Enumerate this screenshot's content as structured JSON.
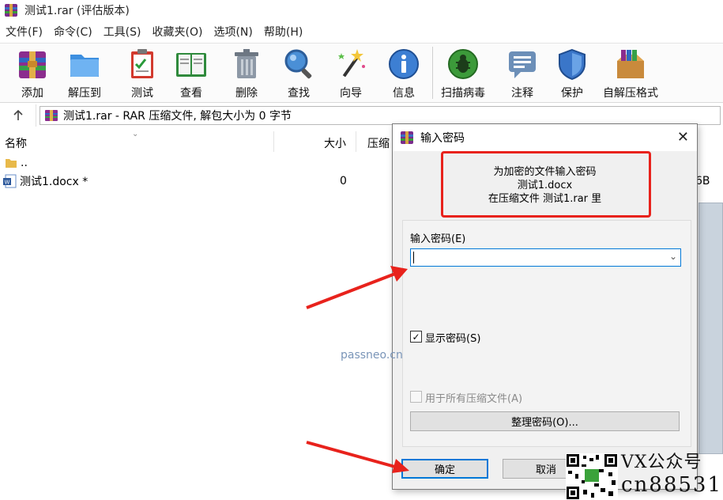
{
  "window": {
    "title": "测试1.rar (评估版本)"
  },
  "menu": [
    "文件(F)",
    "命令(C)",
    "工具(S)",
    "收藏夹(O)",
    "选项(N)",
    "帮助(H)"
  ],
  "toolbar": {
    "add": "添加",
    "extract": "解压到",
    "test": "测试",
    "view": "查看",
    "delete": "删除",
    "find": "查找",
    "wizard": "向导",
    "info": "信息",
    "virus": "扫描病毒",
    "comment": "注释",
    "protect": "保护",
    "sfx": "自解压格式"
  },
  "path": {
    "text": "测试1.rar - RAR 压缩文件, 解包大小为 0 字节"
  },
  "columns": {
    "name": "名称",
    "size": "大小",
    "packed": "压缩"
  },
  "files": [
    {
      "name": "..",
      "size": ""
    },
    {
      "name": "测试1.docx *",
      "size": "0"
    }
  ],
  "background_fragment": "6B",
  "dialog": {
    "title": "输入密码",
    "info_line1": "为加密的文件输入密码",
    "info_line2": "测试1.docx",
    "info_line3": "在压缩文件 测试1.rar 里",
    "field_label": "输入密码(E)",
    "password_value": "",
    "show_password": {
      "label": "显示密码(S)",
      "checked": true
    },
    "use_for_all": {
      "label": "用于所有压缩文件(A)",
      "checked": false,
      "disabled": true
    },
    "organize_button": "整理密码(O)...",
    "ok_button": "确定",
    "cancel_button": "取消"
  },
  "watermark": {
    "site": "passneo.cn",
    "line1": "VX公众号",
    "line2": "cn88531"
  },
  "colors": {
    "accent": "#0078d7",
    "highlight_red": "#e8221c"
  }
}
